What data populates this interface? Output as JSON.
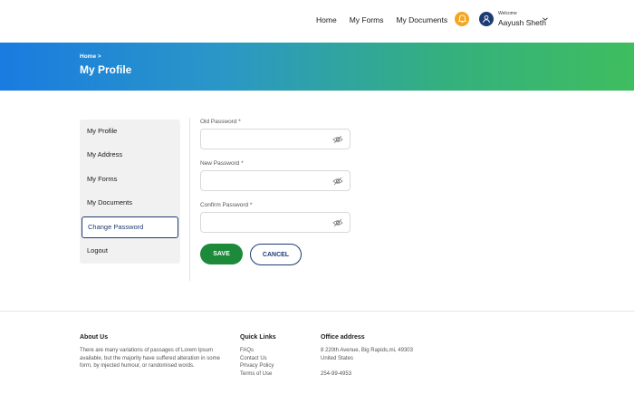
{
  "header": {
    "nav": [
      "Home",
      "My Forms",
      "My Documents"
    ],
    "user": {
      "welcome": "Welcome",
      "name": "Aayush Sheth"
    }
  },
  "banner": {
    "breadcrumb": "Home >",
    "title": "My Profile"
  },
  "sidebar": {
    "items": [
      {
        "label": "My Profile"
      },
      {
        "label": "My Address"
      },
      {
        "label": "My Forms"
      },
      {
        "label": "My Documents"
      },
      {
        "label": "Change Password",
        "active": true
      },
      {
        "label": "Logout"
      }
    ]
  },
  "form": {
    "old_password_label": "Old Password *",
    "new_password_label": "New Password *",
    "confirm_password_label": "Confirm Password *",
    "save_label": "SAVE",
    "cancel_label": "CANCEL"
  },
  "footer": {
    "about": {
      "heading": "About Us",
      "text": "There are many variations of passages of Lorem Ipsum available, but the majority have suffered alteration in some form, by injected humour, or randomised words."
    },
    "quick_links": {
      "heading": "Quick Links",
      "links": [
        "FAQs",
        "Contact Us",
        "Privacy Policy",
        "Terms of Use"
      ]
    },
    "office": {
      "heading": "Office address",
      "address_line1": "8 220th Avenue, Big Rapids,mi, 49303",
      "address_line2": "United States",
      "phone": "254-99-4953"
    }
  },
  "colors": {
    "accent_navy": "#1d3b73",
    "save_green": "#1c8a3a",
    "bell_orange": "#f4a623",
    "banner_start": "#1a7be0",
    "banner_end": "#3fbd5f"
  },
  "icons": [
    "bell-icon",
    "user-icon",
    "chevron-down-icon",
    "eye-off-icon"
  ]
}
